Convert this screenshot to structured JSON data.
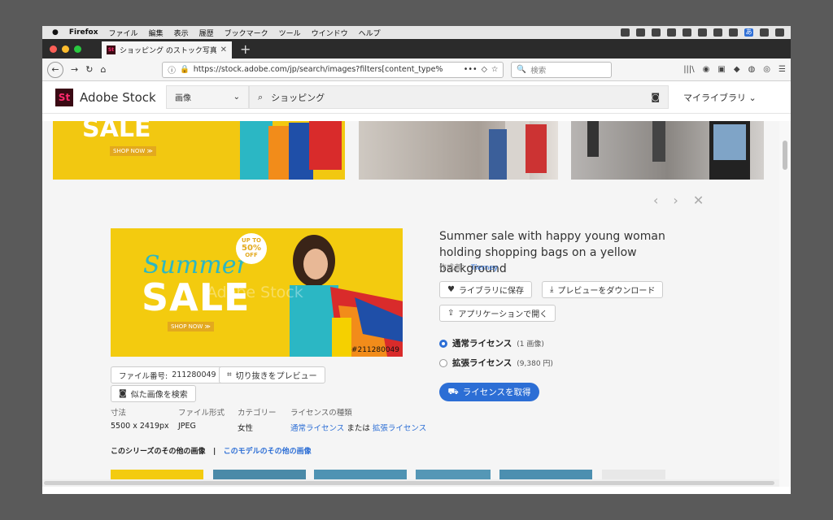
{
  "menubar": {
    "apple": "",
    "app": "Firefox",
    "items": [
      "ファイル",
      "編集",
      "表示",
      "履歴",
      "ブックマーク",
      "ツール",
      "ウインドウ",
      "ヘルプ"
    ],
    "input_mode": "あ"
  },
  "tab": {
    "title": "ショッピング のストック写真、ロ",
    "close": "✕",
    "new": "+"
  },
  "nav": {
    "url": "https://stock.adobe.com/jp/search/images?filters[content_type%",
    "search_placeholder": "検索",
    "more": "•••"
  },
  "header": {
    "logo": "St",
    "brand": "Adobe Stock",
    "filter": "画像",
    "query": "ショッピング",
    "my_library": "マイライブラリ"
  },
  "thumbs": {
    "sale": "SALE",
    "shop_now": "SHOP NOW ≫"
  },
  "detail": {
    "hero": {
      "summer": "Summer",
      "sale": "SALE",
      "badge_top": "UP TO",
      "badge_pct": "50%",
      "badge_off": "OFF",
      "shop_now": "SHOP NOW ≫",
      "id_tag": "#211280049",
      "watermark": "Adobe Stock"
    },
    "title": "Summer sale with happy young woman holding shopping bags on a yellow background",
    "author_label": "作成者：",
    "author": "Tierney",
    "save_library": "ライブラリに保存",
    "download_preview": "プレビューをダウンロード",
    "open_app": "アプリケーションで開く",
    "file_no_label": "ファイル番号:",
    "file_no": "211280049",
    "crop_preview": "切り抜きをプレビュー",
    "similar": "似た画像を検索",
    "license_standard": "通常ライセンス",
    "license_standard_note": "(1 画像)",
    "license_extended": "拡張ライセンス",
    "license_extended_note": "(9,380 円)",
    "get_license": "ライセンスを取得",
    "meta": {
      "size_h": "寸法",
      "size_v": "5500 x 2419px",
      "format_h": "ファイル形式",
      "format_v": "JPEG",
      "cat_h": "カテゴリー",
      "cat_v": "女性",
      "lic_h": "ライセンスの種類",
      "lic_v1": "通常ライセンス",
      "lic_or": "または",
      "lic_v2": "拡張ライセンス"
    },
    "series": "このシリーズのその他の画像",
    "sep": "|",
    "model": "このモデルのその他の画像"
  },
  "colors": {
    "accent": "#2c6ed5",
    "yellow": "#f3cb0f",
    "brand_bg": "#3a0a14",
    "brand_fg": "#ff2a6d"
  }
}
